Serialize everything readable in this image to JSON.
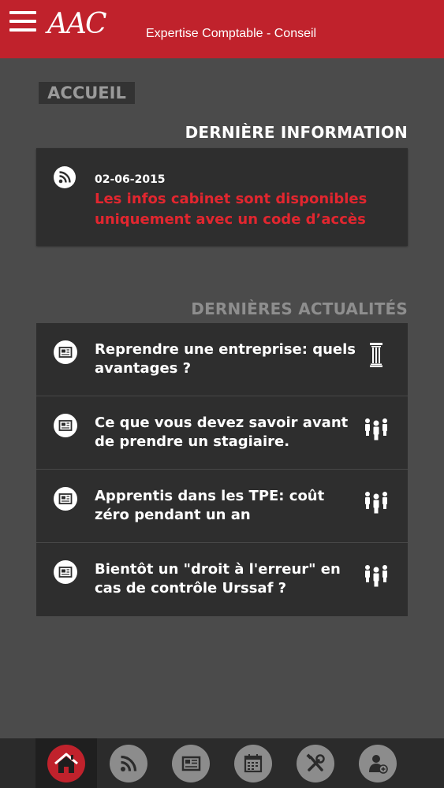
{
  "header": {
    "logo": "AAC",
    "tagline": "Expertise Comptable - Conseil",
    "menu_icon": "hamburger-menu-icon",
    "color": "#c0222c"
  },
  "page": {
    "breadcrumb": "ACCUEIL"
  },
  "last_info": {
    "section_title": "DERNIÈRE INFORMATION",
    "icon": "rss-icon",
    "date": "02-06-2015",
    "text": "Les infos cabinet sont disponibles uniquement avec un code d’accès"
  },
  "news": {
    "section_title": "DERNIÈRES ACTUALITÉS",
    "items": [
      {
        "title": "Reprendre une entreprise: quels avantages ?",
        "icon": "newspaper-icon",
        "category_icon": "column-pillar-icon"
      },
      {
        "title": "Ce que vous devez savoir avant de prendre un stagiaire.",
        "icon": "newspaper-icon",
        "category_icon": "people-group-icon"
      },
      {
        "title": "Apprentis dans les TPE: coût zéro pendant un an",
        "icon": "newspaper-icon",
        "category_icon": "people-group-icon"
      },
      {
        "title": "Bientôt un \"droit à l'erreur\" en cas de contrôle Urssaf ?",
        "icon": "newspaper-icon",
        "category_icon": "people-group-icon"
      }
    ]
  },
  "bottom_nav": {
    "items": [
      {
        "icon": "home-icon",
        "active": true
      },
      {
        "icon": "rss-icon",
        "active": false
      },
      {
        "icon": "newspaper-icon",
        "active": false
      },
      {
        "icon": "calendar-icon",
        "active": false
      },
      {
        "icon": "tools-icon",
        "active": false
      },
      {
        "icon": "add-user-icon",
        "active": false
      }
    ]
  }
}
